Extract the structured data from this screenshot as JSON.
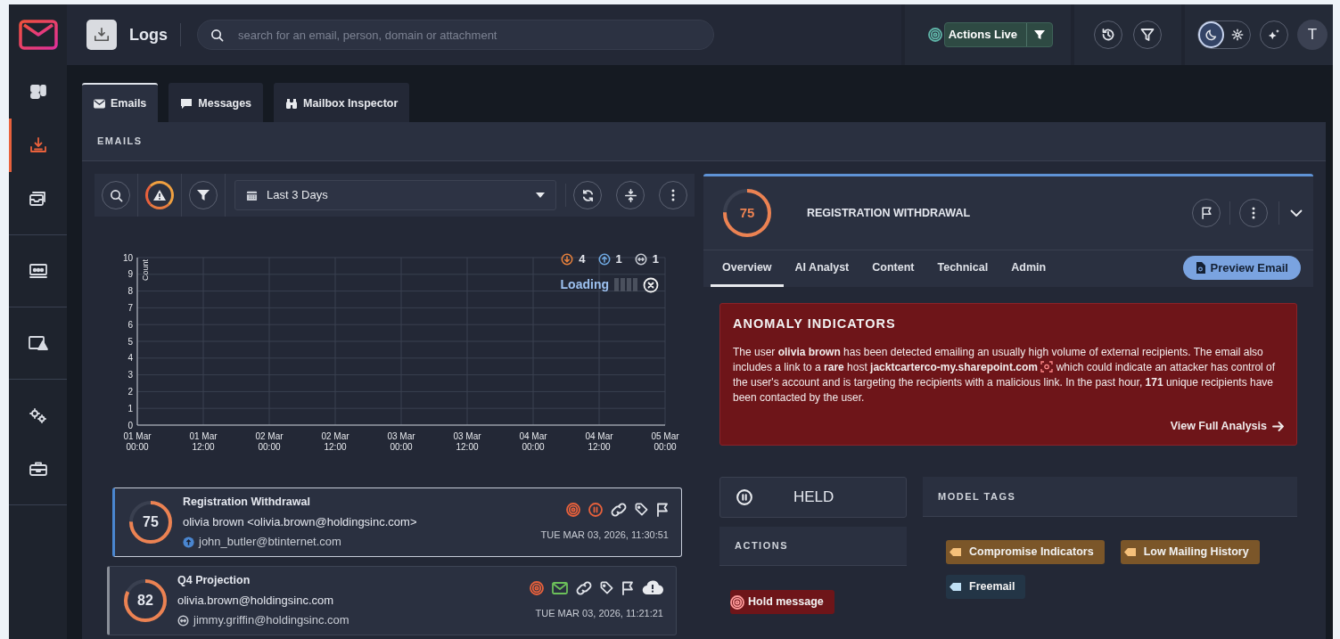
{
  "sidebar": {
    "items": [
      {
        "selected": false
      },
      {
        "selected": true
      },
      {
        "selected": false
      },
      {
        "selected": false
      },
      {
        "selected": false
      },
      {
        "selected": false
      },
      {
        "selected": false
      }
    ]
  },
  "header": {
    "title": "Logs",
    "search": {
      "placeholder": "search for an email, person, domain or attachment"
    },
    "actions_live": {
      "label": "Actions Live"
    },
    "theme_options": [
      {
        "selected": true
      },
      {
        "selected": false
      }
    ],
    "avatar": "T"
  },
  "tabs": [
    {
      "label": "Emails",
      "selected": true
    },
    {
      "label": "Messages",
      "selected": false
    },
    {
      "label": "Mailbox Inspector",
      "selected": false
    }
  ],
  "section_title": "EMAILS",
  "toolbar": {
    "alert_filter_on": true,
    "date_range": "Last 3 Days"
  },
  "legend": [
    {
      "kind": "inbound",
      "count": "4"
    },
    {
      "kind": "outbound",
      "count": "1"
    },
    {
      "kind": "internal",
      "count": "1"
    }
  ],
  "loading": {
    "label": "Loading"
  },
  "chart_data": {
    "type": "bar",
    "grid": true,
    "ylabel": "Count",
    "ylim": [
      0,
      10
    ],
    "yticks": [
      0,
      1,
      2,
      3,
      4,
      5,
      6,
      7,
      8,
      9,
      10
    ],
    "categories": [
      "01 Mar 00:00",
      "01 Mar 12:00",
      "02 Mar 00:00",
      "02 Mar 12:00",
      "03 Mar 00:00",
      "03 Mar 12:00",
      "04 Mar 00:00",
      "04 Mar 12:00",
      "05 Mar 00:00"
    ],
    "values": [
      null,
      null,
      null,
      null,
      null,
      null,
      null,
      null,
      null
    ]
  },
  "emails": [
    {
      "selected": true,
      "score": "75",
      "subject": "Registration Withdrawal",
      "from": "olivia brown <olivia.brown@holdingsinc.com>",
      "recipient": {
        "kind": "outbound",
        "address": "john_butler@btinternet.com"
      },
      "indicators": [
        {
          "kind": "target"
        },
        {
          "kind": "held"
        },
        {
          "kind": "link"
        },
        {
          "kind": "tag"
        },
        {
          "kind": "flag"
        }
      ],
      "time": "TUE MAR 03, 2026, 11:30:51"
    },
    {
      "selected": false,
      "score": "82",
      "subject": "Q4 Projection",
      "from": "olivia.brown@holdingsinc.com",
      "recipient": {
        "kind": "internal",
        "address": "jimmy.griffin@holdingsinc.com"
      },
      "indicators": [
        {
          "kind": "target"
        },
        {
          "kind": "delivered"
        },
        {
          "kind": "link"
        },
        {
          "kind": "tag"
        },
        {
          "kind": "flag"
        },
        {
          "kind": "cloud"
        }
      ],
      "time": "TUE MAR 03, 2026, 11:21:21"
    }
  ],
  "detail": {
    "score": "75",
    "title": "REGISTRATION WITHDRAWAL",
    "tabs": [
      {
        "label": "Overview",
        "selected": true
      },
      {
        "label": "AI Analyst",
        "selected": false
      },
      {
        "label": "Content",
        "selected": false
      },
      {
        "label": "Technical",
        "selected": false
      },
      {
        "label": "Admin",
        "selected": false
      }
    ],
    "preview_button": "Preview Email",
    "anomaly": {
      "title": "ANOMALY INDICATORS",
      "text_before_icon": "The user **olivia brown** has been detected emailing an usually high volume of external recipients. The email also includes a link to a **rare** host **jacktcarterco-my.sharepoint.com**",
      "text_after_icon": "which could indicate an attacker has control of the user's account and is targeting the recipients with a malicious link. In the past hour, **171** unique recipients have been contacted by the user.",
      "link": "View Full Analysis"
    },
    "status": {
      "label": "HELD"
    },
    "actions": {
      "title": "ACTIONS",
      "items": [
        {
          "label": "Hold message"
        }
      ]
    },
    "model_tags": {
      "title": "MODEL TAGS",
      "tags": [
        {
          "label": "Compromise Indicators",
          "color": "#7b5629"
        },
        {
          "label": "Low Mailing History",
          "color": "#7b5629"
        },
        {
          "label": "Freemail",
          "color": "#233546"
        }
      ]
    }
  }
}
